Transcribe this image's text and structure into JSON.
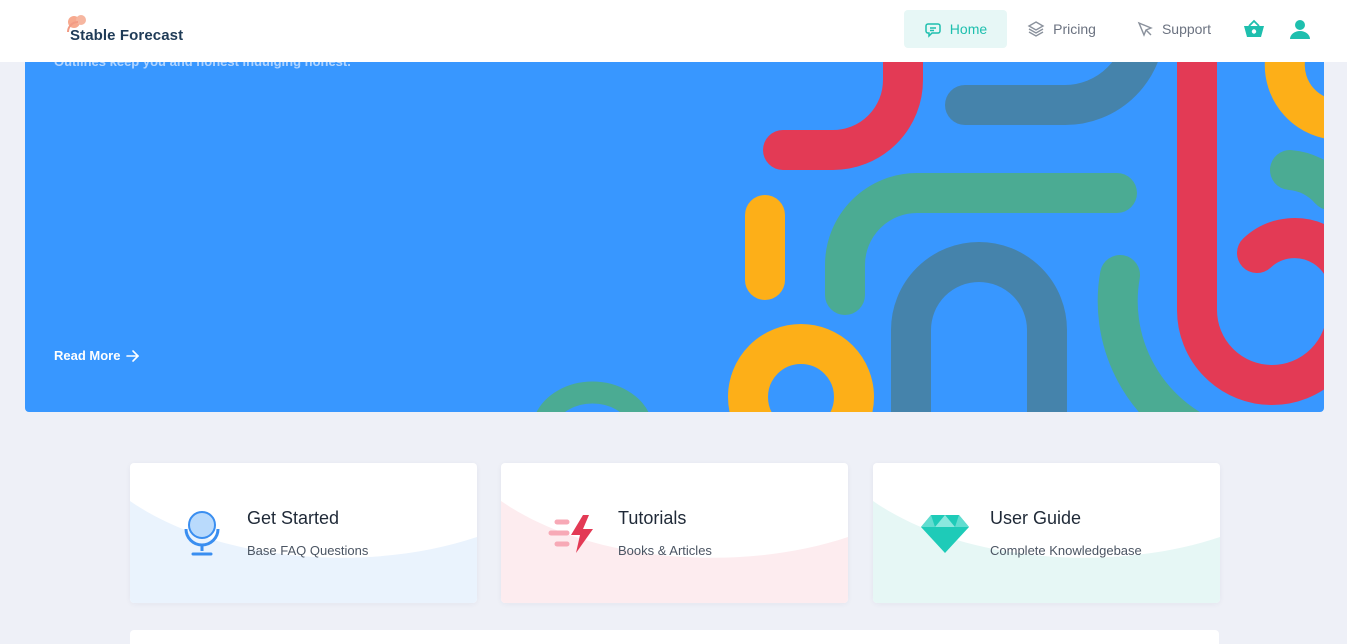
{
  "brand": {
    "name": "Stable Forecast"
  },
  "nav": {
    "items": [
      {
        "label": "Home",
        "icon": "chat-bubble-icon",
        "active": true
      },
      {
        "label": "Pricing",
        "icon": "layers-icon",
        "active": false
      },
      {
        "label": "Support",
        "icon": "rocket-icon",
        "active": false
      }
    ],
    "cart_icon": "basket-icon",
    "user_icon": "user-icon"
  },
  "hero": {
    "subtitle": "Outlines keep you and honest indulging honest.",
    "read_more": "Read More"
  },
  "cards": [
    {
      "title": "Get Started",
      "subtitle": "Base FAQ Questions",
      "icon": "microphone-icon",
      "tint": "#eaf3fd"
    },
    {
      "title": "Tutorials",
      "subtitle": "Books & Articles",
      "icon": "lightning-icon",
      "tint": "#fdecef"
    },
    {
      "title": "User Guide",
      "subtitle": "Complete Knowledgebase",
      "icon": "diamond-icon",
      "tint": "#e6f7f5"
    }
  ],
  "colors": {
    "accent": "#1ebfae",
    "hero": "#3897ff",
    "red": "#e33a55",
    "yellow": "#fdaf18",
    "green": "#4bab93",
    "steel": "#4583ab"
  }
}
